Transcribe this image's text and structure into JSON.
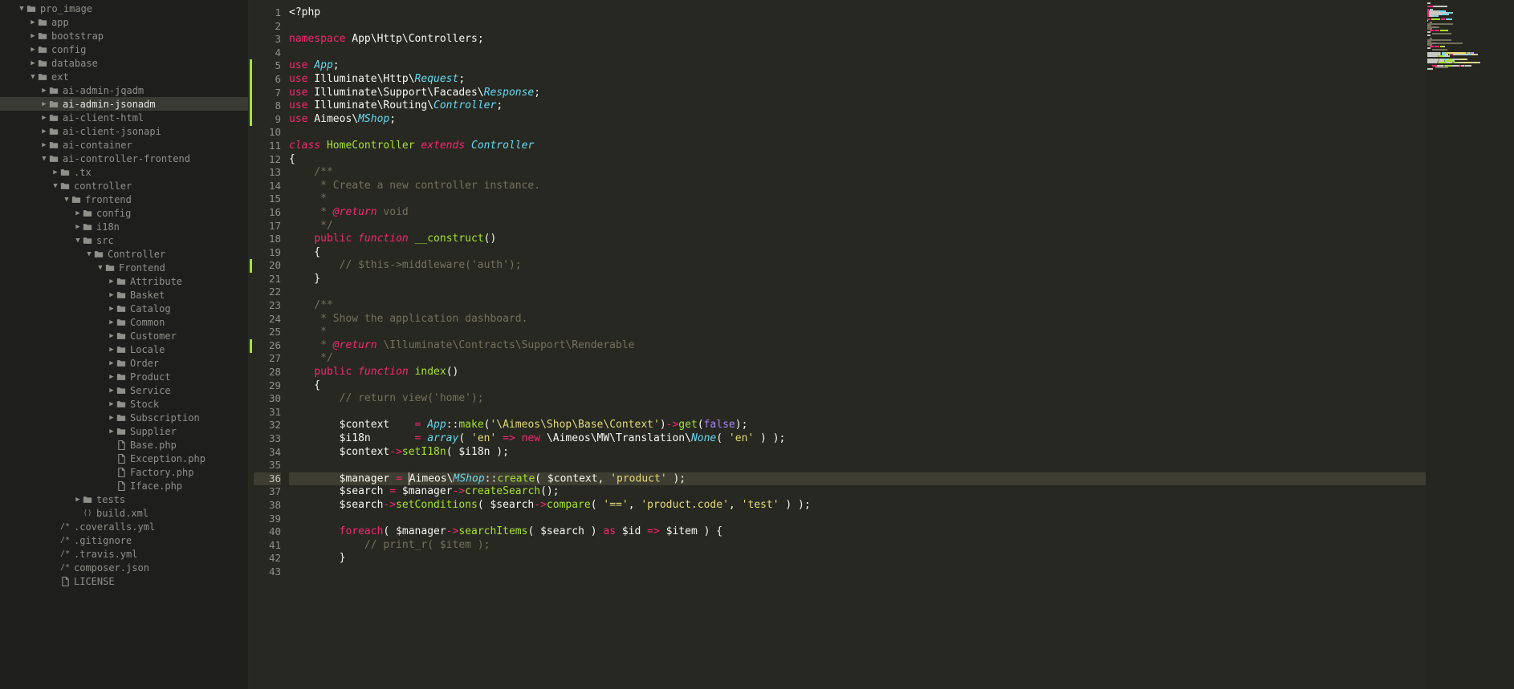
{
  "sidebar": {
    "root": "pro_image",
    "tree": [
      {
        "level": 1,
        "type": "folder",
        "expanded": true,
        "name": "pro_image"
      },
      {
        "level": 2,
        "type": "folder",
        "expanded": false,
        "name": "app"
      },
      {
        "level": 2,
        "type": "folder",
        "expanded": false,
        "name": "bootstrap"
      },
      {
        "level": 2,
        "type": "folder",
        "expanded": false,
        "name": "config"
      },
      {
        "level": 2,
        "type": "folder",
        "expanded": false,
        "name": "database"
      },
      {
        "level": 2,
        "type": "folder",
        "expanded": true,
        "name": "ext"
      },
      {
        "level": 3,
        "type": "folder",
        "expanded": false,
        "name": "ai-admin-jqadm"
      },
      {
        "level": 3,
        "type": "folder",
        "expanded": false,
        "name": "ai-admin-jsonadm",
        "selected": true
      },
      {
        "level": 3,
        "type": "folder",
        "expanded": false,
        "name": "ai-client-html"
      },
      {
        "level": 3,
        "type": "folder",
        "expanded": false,
        "name": "ai-client-jsonapi"
      },
      {
        "level": 3,
        "type": "folder",
        "expanded": false,
        "name": "ai-container"
      },
      {
        "level": 3,
        "type": "folder",
        "expanded": true,
        "name": "ai-controller-frontend"
      },
      {
        "level": 4,
        "type": "folder",
        "expanded": false,
        "name": ".tx"
      },
      {
        "level": 4,
        "type": "folder",
        "expanded": true,
        "name": "controller"
      },
      {
        "level": 5,
        "type": "folder",
        "expanded": true,
        "name": "frontend"
      },
      {
        "level": 6,
        "type": "folder",
        "expanded": false,
        "name": "config"
      },
      {
        "level": 6,
        "type": "folder",
        "expanded": false,
        "name": "i18n"
      },
      {
        "level": 6,
        "type": "folder",
        "expanded": true,
        "name": "src"
      },
      {
        "level": 7,
        "type": "folder",
        "expanded": true,
        "name": "Controller"
      },
      {
        "level": 8,
        "type": "folder",
        "expanded": true,
        "name": "Frontend"
      },
      {
        "level": 9,
        "type": "folder",
        "expanded": false,
        "name": "Attribute"
      },
      {
        "level": 9,
        "type": "folder",
        "expanded": false,
        "name": "Basket"
      },
      {
        "level": 9,
        "type": "folder",
        "expanded": false,
        "name": "Catalog"
      },
      {
        "level": 9,
        "type": "folder",
        "expanded": false,
        "name": "Common"
      },
      {
        "level": 9,
        "type": "folder",
        "expanded": false,
        "name": "Customer"
      },
      {
        "level": 9,
        "type": "folder",
        "expanded": false,
        "name": "Locale"
      },
      {
        "level": 9,
        "type": "folder",
        "expanded": false,
        "name": "Order"
      },
      {
        "level": 9,
        "type": "folder",
        "expanded": false,
        "name": "Product"
      },
      {
        "level": 9,
        "type": "folder",
        "expanded": false,
        "name": "Service"
      },
      {
        "level": 9,
        "type": "folder",
        "expanded": false,
        "name": "Stock"
      },
      {
        "level": 9,
        "type": "folder",
        "expanded": false,
        "name": "Subscription"
      },
      {
        "level": 9,
        "type": "folder",
        "expanded": false,
        "name": "Supplier"
      },
      {
        "level": 9,
        "type": "file-php",
        "name": "Base.php"
      },
      {
        "level": 9,
        "type": "file-php",
        "name": "Exception.php"
      },
      {
        "level": 9,
        "type": "file-php",
        "name": "Factory.php"
      },
      {
        "level": 9,
        "type": "file-php",
        "name": "Iface.php"
      },
      {
        "level": 6,
        "type": "folder",
        "expanded": false,
        "name": "tests"
      },
      {
        "level": 6,
        "type": "file-xml",
        "name": "build.xml"
      },
      {
        "level": 4,
        "type": "file-special",
        "name": ".coveralls.yml"
      },
      {
        "level": 4,
        "type": "file-special",
        "name": ".gitignore"
      },
      {
        "level": 4,
        "type": "file-special",
        "name": ".travis.yml"
      },
      {
        "level": 4,
        "type": "file-special",
        "name": "composer.json"
      },
      {
        "level": 4,
        "type": "file-generic",
        "name": "LICENSE"
      }
    ]
  },
  "editor": {
    "currentLine": 36,
    "changeMarks": [
      {
        "start": 5,
        "end": 9
      },
      {
        "start": 20,
        "end": 20
      },
      {
        "start": 26,
        "end": 26
      }
    ],
    "lines": [
      {
        "n": 1,
        "tokens": [
          {
            "t": "<?php",
            "c": "tok-var"
          }
        ]
      },
      {
        "n": 2,
        "tokens": []
      },
      {
        "n": 3,
        "tokens": [
          {
            "t": "namespace",
            "c": "tok-keyword2"
          },
          {
            "t": " App\\Http\\Controllers",
            "c": "tok-var"
          },
          {
            "t": ";",
            "c": "tok-var"
          }
        ]
      },
      {
        "n": 4,
        "tokens": []
      },
      {
        "n": 5,
        "tokens": [
          {
            "t": "use",
            "c": "tok-keyword2"
          },
          {
            "t": " ",
            "c": ""
          },
          {
            "t": "App",
            "c": "tok-type"
          },
          {
            "t": ";",
            "c": "tok-var"
          }
        ]
      },
      {
        "n": 6,
        "tokens": [
          {
            "t": "use",
            "c": "tok-keyword2"
          },
          {
            "t": " Illuminate\\Http\\",
            "c": "tok-var"
          },
          {
            "t": "Request",
            "c": "tok-type"
          },
          {
            "t": ";",
            "c": "tok-var"
          }
        ]
      },
      {
        "n": 7,
        "tokens": [
          {
            "t": "use",
            "c": "tok-keyword2"
          },
          {
            "t": " Illuminate\\Support\\Facades\\",
            "c": "tok-var"
          },
          {
            "t": "Response",
            "c": "tok-type"
          },
          {
            "t": ";",
            "c": "tok-var"
          }
        ]
      },
      {
        "n": 8,
        "tokens": [
          {
            "t": "use",
            "c": "tok-keyword2"
          },
          {
            "t": " Illuminate\\Routing\\",
            "c": "tok-var"
          },
          {
            "t": "Controller",
            "c": "tok-type"
          },
          {
            "t": ";",
            "c": "tok-var"
          }
        ]
      },
      {
        "n": 9,
        "tokens": [
          {
            "t": "use",
            "c": "tok-keyword2"
          },
          {
            "t": " Aimeos\\",
            "c": "tok-var"
          },
          {
            "t": "MShop",
            "c": "tok-type"
          },
          {
            "t": ";",
            "c": "tok-var"
          }
        ]
      },
      {
        "n": 10,
        "tokens": []
      },
      {
        "n": 11,
        "tokens": [
          {
            "t": "class",
            "c": "tok-keyword"
          },
          {
            "t": " ",
            "c": ""
          },
          {
            "t": "HomeController",
            "c": "tok-class"
          },
          {
            "t": " ",
            "c": ""
          },
          {
            "t": "extends",
            "c": "tok-keyword"
          },
          {
            "t": " ",
            "c": ""
          },
          {
            "t": "Controller",
            "c": "tok-type"
          }
        ]
      },
      {
        "n": 12,
        "tokens": [
          {
            "t": "{",
            "c": "tok-var"
          }
        ]
      },
      {
        "n": 13,
        "tokens": [
          {
            "t": "    ",
            "c": ""
          },
          {
            "t": "/**",
            "c": "tok-comment"
          }
        ]
      },
      {
        "n": 14,
        "tokens": [
          {
            "t": "     * Create a new controller instance.",
            "c": "tok-comment"
          }
        ]
      },
      {
        "n": 15,
        "tokens": [
          {
            "t": "     *",
            "c": "tok-comment"
          }
        ]
      },
      {
        "n": 16,
        "tokens": [
          {
            "t": "     * ",
            "c": "tok-comment"
          },
          {
            "t": "@return",
            "c": "tok-doc"
          },
          {
            "t": " void",
            "c": "tok-comment"
          }
        ]
      },
      {
        "n": 17,
        "tokens": [
          {
            "t": "     */",
            "c": "tok-comment"
          }
        ]
      },
      {
        "n": 18,
        "tokens": [
          {
            "t": "    ",
            "c": ""
          },
          {
            "t": "public",
            "c": "tok-keyword2"
          },
          {
            "t": " ",
            "c": ""
          },
          {
            "t": "function",
            "c": "tok-keyword"
          },
          {
            "t": " ",
            "c": ""
          },
          {
            "t": "__construct",
            "c": "tok-func"
          },
          {
            "t": "()",
            "c": "tok-var"
          }
        ]
      },
      {
        "n": 19,
        "tokens": [
          {
            "t": "    {",
            "c": "tok-var"
          }
        ]
      },
      {
        "n": 20,
        "tokens": [
          {
            "t": "        ",
            "c": ""
          },
          {
            "t": "// $this->middleware('auth');",
            "c": "tok-comment"
          }
        ]
      },
      {
        "n": 21,
        "tokens": [
          {
            "t": "    }",
            "c": "tok-var"
          }
        ]
      },
      {
        "n": 22,
        "tokens": []
      },
      {
        "n": 23,
        "tokens": [
          {
            "t": "    ",
            "c": ""
          },
          {
            "t": "/**",
            "c": "tok-comment"
          }
        ]
      },
      {
        "n": 24,
        "tokens": [
          {
            "t": "     * Show the application dashboard.",
            "c": "tok-comment"
          }
        ]
      },
      {
        "n": 25,
        "tokens": [
          {
            "t": "     *",
            "c": "tok-comment"
          }
        ]
      },
      {
        "n": 26,
        "tokens": [
          {
            "t": "     * ",
            "c": "tok-comment"
          },
          {
            "t": "@return",
            "c": "tok-doc"
          },
          {
            "t": " \\Illuminate\\Contracts\\Support\\Renderable",
            "c": "tok-comment"
          }
        ]
      },
      {
        "n": 27,
        "tokens": [
          {
            "t": "     */",
            "c": "tok-comment"
          }
        ]
      },
      {
        "n": 28,
        "tokens": [
          {
            "t": "    ",
            "c": ""
          },
          {
            "t": "public",
            "c": "tok-keyword2"
          },
          {
            "t": " ",
            "c": ""
          },
          {
            "t": "function",
            "c": "tok-keyword"
          },
          {
            "t": " ",
            "c": ""
          },
          {
            "t": "index",
            "c": "tok-func"
          },
          {
            "t": "()",
            "c": "tok-var"
          }
        ]
      },
      {
        "n": 29,
        "tokens": [
          {
            "t": "    {",
            "c": "tok-var"
          }
        ]
      },
      {
        "n": 30,
        "tokens": [
          {
            "t": "        ",
            "c": ""
          },
          {
            "t": "// return view('home');",
            "c": "tok-comment"
          }
        ]
      },
      {
        "n": 31,
        "tokens": []
      },
      {
        "n": 32,
        "tokens": [
          {
            "t": "        $context    ",
            "c": "tok-var"
          },
          {
            "t": "=",
            "c": "tok-op"
          },
          {
            "t": " ",
            "c": ""
          },
          {
            "t": "App",
            "c": "tok-type"
          },
          {
            "t": "::",
            "c": "tok-var"
          },
          {
            "t": "make",
            "c": "tok-func"
          },
          {
            "t": "(",
            "c": "tok-var"
          },
          {
            "t": "'\\Aimeos\\Shop\\Base\\Context'",
            "c": "tok-string"
          },
          {
            "t": ")",
            "c": "tok-var"
          },
          {
            "t": "->",
            "c": "tok-op"
          },
          {
            "t": "get",
            "c": "tok-func"
          },
          {
            "t": "(",
            "c": "tok-var"
          },
          {
            "t": "false",
            "c": "tok-const"
          },
          {
            "t": ");",
            "c": "tok-var"
          }
        ]
      },
      {
        "n": 33,
        "tokens": [
          {
            "t": "        $i18n       ",
            "c": "tok-var"
          },
          {
            "t": "=",
            "c": "tok-op"
          },
          {
            "t": " ",
            "c": ""
          },
          {
            "t": "array",
            "c": "tok-type"
          },
          {
            "t": "( ",
            "c": "tok-var"
          },
          {
            "t": "'en'",
            "c": "tok-string"
          },
          {
            "t": " ",
            "c": ""
          },
          {
            "t": "=>",
            "c": "tok-op"
          },
          {
            "t": " ",
            "c": ""
          },
          {
            "t": "new",
            "c": "tok-keyword2"
          },
          {
            "t": " \\Aimeos\\MW\\Translation\\",
            "c": "tok-var"
          },
          {
            "t": "None",
            "c": "tok-type"
          },
          {
            "t": "( ",
            "c": "tok-var"
          },
          {
            "t": "'en'",
            "c": "tok-string"
          },
          {
            "t": " ) );",
            "c": "tok-var"
          }
        ]
      },
      {
        "n": 34,
        "tokens": [
          {
            "t": "        $context",
            "c": "tok-var"
          },
          {
            "t": "->",
            "c": "tok-op"
          },
          {
            "t": "setI18n",
            "c": "tok-func"
          },
          {
            "t": "( $i18n );",
            "c": "tok-var"
          }
        ]
      },
      {
        "n": 35,
        "tokens": []
      },
      {
        "n": 36,
        "tokens": [
          {
            "t": "        $manager ",
            "c": "tok-var"
          },
          {
            "t": "=",
            "c": "tok-op"
          },
          {
            "t": " ",
            "c": ""
          },
          {
            "t": "|",
            "c": "cursor-caret-placeholder"
          },
          {
            "t": "Aimeos\\",
            "c": "tok-var"
          },
          {
            "t": "MShop",
            "c": "tok-type"
          },
          {
            "t": "::",
            "c": "tok-var"
          },
          {
            "t": "create",
            "c": "tok-func"
          },
          {
            "t": "( $context, ",
            "c": "tok-var"
          },
          {
            "t": "'product'",
            "c": "tok-string"
          },
          {
            "t": " );",
            "c": "tok-var"
          }
        ]
      },
      {
        "n": 37,
        "tokens": [
          {
            "t": "        $search ",
            "c": "tok-var"
          },
          {
            "t": "=",
            "c": "tok-op"
          },
          {
            "t": " $manager",
            "c": "tok-var"
          },
          {
            "t": "->",
            "c": "tok-op"
          },
          {
            "t": "createSearch",
            "c": "tok-func"
          },
          {
            "t": "();",
            "c": "tok-var"
          }
        ]
      },
      {
        "n": 38,
        "tokens": [
          {
            "t": "        $search",
            "c": "tok-var"
          },
          {
            "t": "->",
            "c": "tok-op"
          },
          {
            "t": "setConditions",
            "c": "tok-func"
          },
          {
            "t": "( $search",
            "c": "tok-var"
          },
          {
            "t": "->",
            "c": "tok-op"
          },
          {
            "t": "compare",
            "c": "tok-func"
          },
          {
            "t": "( ",
            "c": "tok-var"
          },
          {
            "t": "'=='",
            "c": "tok-string"
          },
          {
            "t": ", ",
            "c": "tok-var"
          },
          {
            "t": "'product.code'",
            "c": "tok-string"
          },
          {
            "t": ", ",
            "c": "tok-var"
          },
          {
            "t": "'test'",
            "c": "tok-string"
          },
          {
            "t": " ) );",
            "c": "tok-var"
          }
        ]
      },
      {
        "n": 39,
        "tokens": []
      },
      {
        "n": 40,
        "tokens": [
          {
            "t": "        ",
            "c": ""
          },
          {
            "t": "foreach",
            "c": "tok-keyword2"
          },
          {
            "t": "( $manager",
            "c": "tok-var"
          },
          {
            "t": "->",
            "c": "tok-op"
          },
          {
            "t": "searchItems",
            "c": "tok-func"
          },
          {
            "t": "( $search ) ",
            "c": "tok-var"
          },
          {
            "t": "as",
            "c": "tok-keyword2"
          },
          {
            "t": " $id ",
            "c": "tok-var"
          },
          {
            "t": "=>",
            "c": "tok-op"
          },
          {
            "t": " $item ) {",
            "c": "tok-var"
          }
        ]
      },
      {
        "n": 41,
        "tokens": [
          {
            "t": "            ",
            "c": ""
          },
          {
            "t": "// print_r( $item );",
            "c": "tok-comment"
          }
        ]
      },
      {
        "n": 42,
        "tokens": [
          {
            "t": "        }",
            "c": "tok-var"
          }
        ]
      },
      {
        "n": 43,
        "tokens": []
      }
    ]
  }
}
